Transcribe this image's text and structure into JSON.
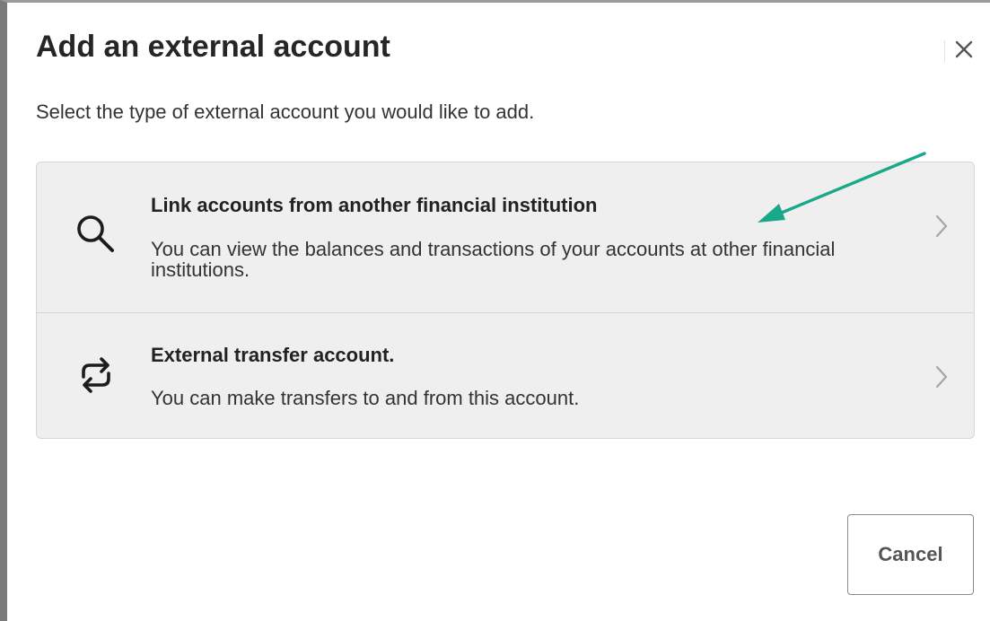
{
  "dialog": {
    "title": "Add an external account",
    "instruction": "Select the type of external account you would like to add.",
    "close_icon": "close-icon"
  },
  "options": [
    {
      "title": "Link accounts from another financial institution",
      "description": "You can view the balances and transactions of your accounts at other financial institutions.",
      "icon": "search-icon"
    },
    {
      "title": "External transfer account.",
      "description": "You can make transfers to and from this account.",
      "icon": "transfer-icon"
    }
  ],
  "annotation": {
    "color": "#1aa88a",
    "icon": "arrow-annotation"
  },
  "footer": {
    "cancel_label": "Cancel"
  }
}
